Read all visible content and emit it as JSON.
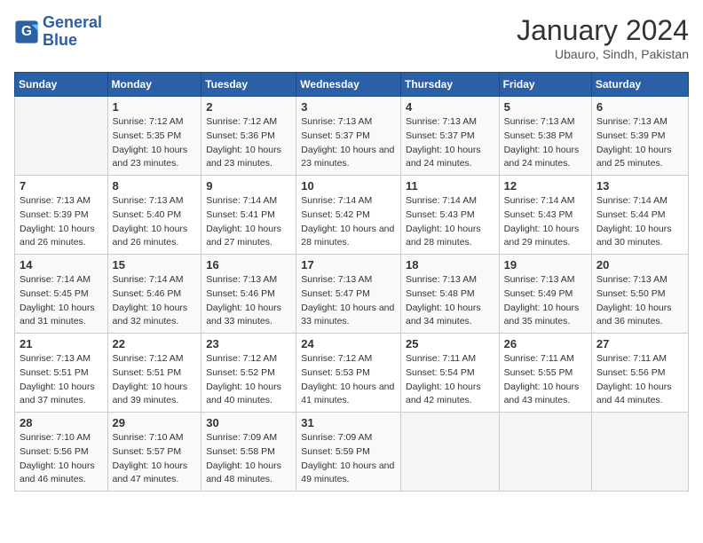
{
  "header": {
    "logo_general": "General",
    "logo_blue": "Blue",
    "month_title": "January 2024",
    "location": "Ubauro, Sindh, Pakistan"
  },
  "calendar": {
    "days_of_week": [
      "Sunday",
      "Monday",
      "Tuesday",
      "Wednesday",
      "Thursday",
      "Friday",
      "Saturday"
    ],
    "weeks": [
      [
        {
          "day": "",
          "sunrise": "",
          "sunset": "",
          "daylight": ""
        },
        {
          "day": "1",
          "sunrise": "Sunrise: 7:12 AM",
          "sunset": "Sunset: 5:35 PM",
          "daylight": "Daylight: 10 hours and 23 minutes."
        },
        {
          "day": "2",
          "sunrise": "Sunrise: 7:12 AM",
          "sunset": "Sunset: 5:36 PM",
          "daylight": "Daylight: 10 hours and 23 minutes."
        },
        {
          "day": "3",
          "sunrise": "Sunrise: 7:13 AM",
          "sunset": "Sunset: 5:37 PM",
          "daylight": "Daylight: 10 hours and 23 minutes."
        },
        {
          "day": "4",
          "sunrise": "Sunrise: 7:13 AM",
          "sunset": "Sunset: 5:37 PM",
          "daylight": "Daylight: 10 hours and 24 minutes."
        },
        {
          "day": "5",
          "sunrise": "Sunrise: 7:13 AM",
          "sunset": "Sunset: 5:38 PM",
          "daylight": "Daylight: 10 hours and 24 minutes."
        },
        {
          "day": "6",
          "sunrise": "Sunrise: 7:13 AM",
          "sunset": "Sunset: 5:39 PM",
          "daylight": "Daylight: 10 hours and 25 minutes."
        }
      ],
      [
        {
          "day": "7",
          "sunrise": "Sunrise: 7:13 AM",
          "sunset": "Sunset: 5:39 PM",
          "daylight": "Daylight: 10 hours and 26 minutes."
        },
        {
          "day": "8",
          "sunrise": "Sunrise: 7:13 AM",
          "sunset": "Sunset: 5:40 PM",
          "daylight": "Daylight: 10 hours and 26 minutes."
        },
        {
          "day": "9",
          "sunrise": "Sunrise: 7:14 AM",
          "sunset": "Sunset: 5:41 PM",
          "daylight": "Daylight: 10 hours and 27 minutes."
        },
        {
          "day": "10",
          "sunrise": "Sunrise: 7:14 AM",
          "sunset": "Sunset: 5:42 PM",
          "daylight": "Daylight: 10 hours and 28 minutes."
        },
        {
          "day": "11",
          "sunrise": "Sunrise: 7:14 AM",
          "sunset": "Sunset: 5:43 PM",
          "daylight": "Daylight: 10 hours and 28 minutes."
        },
        {
          "day": "12",
          "sunrise": "Sunrise: 7:14 AM",
          "sunset": "Sunset: 5:43 PM",
          "daylight": "Daylight: 10 hours and 29 minutes."
        },
        {
          "day": "13",
          "sunrise": "Sunrise: 7:14 AM",
          "sunset": "Sunset: 5:44 PM",
          "daylight": "Daylight: 10 hours and 30 minutes."
        }
      ],
      [
        {
          "day": "14",
          "sunrise": "Sunrise: 7:14 AM",
          "sunset": "Sunset: 5:45 PM",
          "daylight": "Daylight: 10 hours and 31 minutes."
        },
        {
          "day": "15",
          "sunrise": "Sunrise: 7:14 AM",
          "sunset": "Sunset: 5:46 PM",
          "daylight": "Daylight: 10 hours and 32 minutes."
        },
        {
          "day": "16",
          "sunrise": "Sunrise: 7:13 AM",
          "sunset": "Sunset: 5:46 PM",
          "daylight": "Daylight: 10 hours and 33 minutes."
        },
        {
          "day": "17",
          "sunrise": "Sunrise: 7:13 AM",
          "sunset": "Sunset: 5:47 PM",
          "daylight": "Daylight: 10 hours and 33 minutes."
        },
        {
          "day": "18",
          "sunrise": "Sunrise: 7:13 AM",
          "sunset": "Sunset: 5:48 PM",
          "daylight": "Daylight: 10 hours and 34 minutes."
        },
        {
          "day": "19",
          "sunrise": "Sunrise: 7:13 AM",
          "sunset": "Sunset: 5:49 PM",
          "daylight": "Daylight: 10 hours and 35 minutes."
        },
        {
          "day": "20",
          "sunrise": "Sunrise: 7:13 AM",
          "sunset": "Sunset: 5:50 PM",
          "daylight": "Daylight: 10 hours and 36 minutes."
        }
      ],
      [
        {
          "day": "21",
          "sunrise": "Sunrise: 7:13 AM",
          "sunset": "Sunset: 5:51 PM",
          "daylight": "Daylight: 10 hours and 37 minutes."
        },
        {
          "day": "22",
          "sunrise": "Sunrise: 7:12 AM",
          "sunset": "Sunset: 5:51 PM",
          "daylight": "Daylight: 10 hours and 39 minutes."
        },
        {
          "day": "23",
          "sunrise": "Sunrise: 7:12 AM",
          "sunset": "Sunset: 5:52 PM",
          "daylight": "Daylight: 10 hours and 40 minutes."
        },
        {
          "day": "24",
          "sunrise": "Sunrise: 7:12 AM",
          "sunset": "Sunset: 5:53 PM",
          "daylight": "Daylight: 10 hours and 41 minutes."
        },
        {
          "day": "25",
          "sunrise": "Sunrise: 7:11 AM",
          "sunset": "Sunset: 5:54 PM",
          "daylight": "Daylight: 10 hours and 42 minutes."
        },
        {
          "day": "26",
          "sunrise": "Sunrise: 7:11 AM",
          "sunset": "Sunset: 5:55 PM",
          "daylight": "Daylight: 10 hours and 43 minutes."
        },
        {
          "day": "27",
          "sunrise": "Sunrise: 7:11 AM",
          "sunset": "Sunset: 5:56 PM",
          "daylight": "Daylight: 10 hours and 44 minutes."
        }
      ],
      [
        {
          "day": "28",
          "sunrise": "Sunrise: 7:10 AM",
          "sunset": "Sunset: 5:56 PM",
          "daylight": "Daylight: 10 hours and 46 minutes."
        },
        {
          "day": "29",
          "sunrise": "Sunrise: 7:10 AM",
          "sunset": "Sunset: 5:57 PM",
          "daylight": "Daylight: 10 hours and 47 minutes."
        },
        {
          "day": "30",
          "sunrise": "Sunrise: 7:09 AM",
          "sunset": "Sunset: 5:58 PM",
          "daylight": "Daylight: 10 hours and 48 minutes."
        },
        {
          "day": "31",
          "sunrise": "Sunrise: 7:09 AM",
          "sunset": "Sunset: 5:59 PM",
          "daylight": "Daylight: 10 hours and 49 minutes."
        },
        {
          "day": "",
          "sunrise": "",
          "sunset": "",
          "daylight": ""
        },
        {
          "day": "",
          "sunrise": "",
          "sunset": "",
          "daylight": ""
        },
        {
          "day": "",
          "sunrise": "",
          "sunset": "",
          "daylight": ""
        }
      ]
    ]
  }
}
